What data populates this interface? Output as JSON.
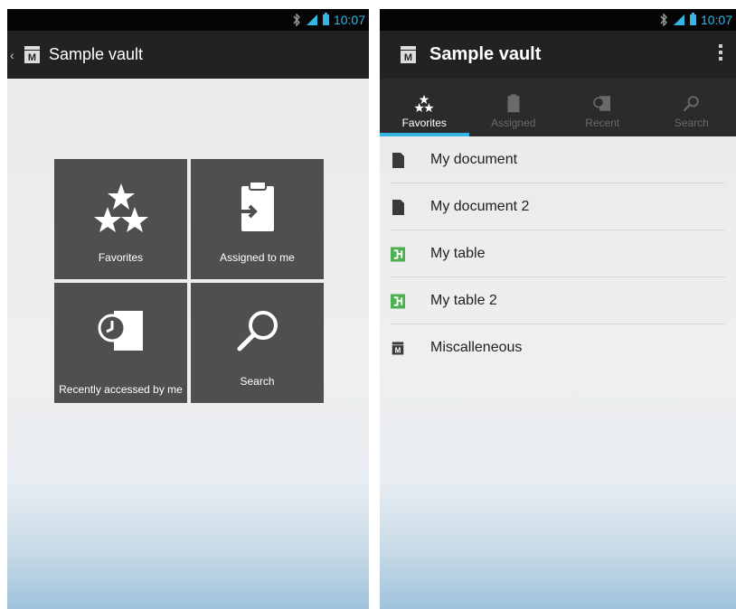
{
  "status": {
    "time": "10:07"
  },
  "left": {
    "title": "Sample vault",
    "tiles": [
      {
        "label": "Favorites"
      },
      {
        "label": "Assigned to me"
      },
      {
        "label": "Recently accessed by  me"
      },
      {
        "label": "Search"
      }
    ]
  },
  "right": {
    "title": "Sample vault",
    "tabs": [
      {
        "label": "Favorites",
        "active": true
      },
      {
        "label": "Assigned",
        "active": false
      },
      {
        "label": "Recent",
        "active": false
      },
      {
        "label": "Search",
        "active": false
      }
    ],
    "items": [
      {
        "label": "My document",
        "icon": "document-icon"
      },
      {
        "label": "My document 2",
        "icon": "document-icon"
      },
      {
        "label": "My table",
        "icon": "table-icon"
      },
      {
        "label": "My table 2",
        "icon": "table-icon"
      },
      {
        "label": "Miscalleneous",
        "icon": "vault-icon"
      }
    ]
  },
  "colors": {
    "accent": "#33b5e5",
    "tile": "#4f4f4f",
    "actionbar": "#222222",
    "tabbar": "#2b2b2b",
    "table_green": "#4caf50"
  }
}
